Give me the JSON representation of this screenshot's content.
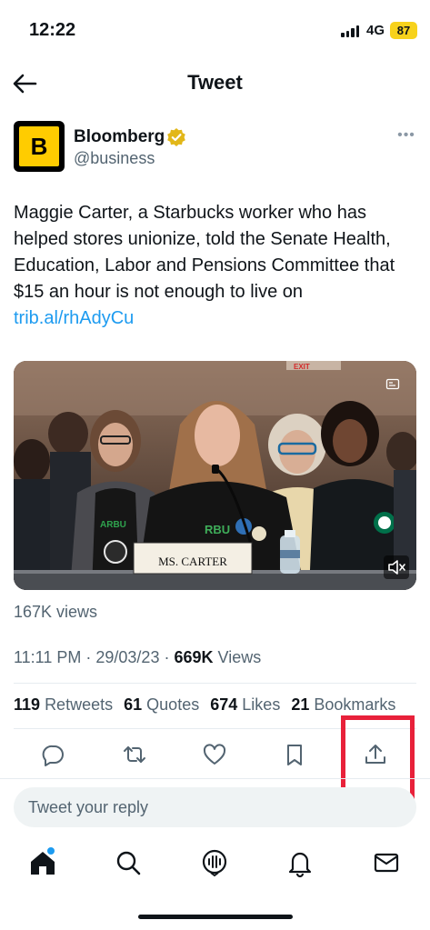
{
  "status_bar": {
    "time": "12:22",
    "network": "4G",
    "battery": "87"
  },
  "header": {
    "title": "Tweet"
  },
  "author": {
    "name": "Bloomberg",
    "handle": "@business",
    "avatar_letter": "B"
  },
  "tweet": {
    "text": "Maggie Carter, a Starbucks worker who has helped stores unionize, told the Senate Health, Education, Labor and Pensions Committee that $15 an hour is not enough to live on ",
    "link": "trib.al/rhAdyCu"
  },
  "media": {
    "nameplate": "MS. CARTER",
    "jersey_text": "RBU",
    "exit_sign": "EXIT"
  },
  "views_label": "167K views",
  "meta": {
    "time": "11:11 PM",
    "date": "29/03/23",
    "views_count": "669K",
    "views_label": "Views"
  },
  "stats": [
    {
      "count": "119",
      "label": "Retweets"
    },
    {
      "count": "61",
      "label": "Quotes"
    },
    {
      "count": "674",
      "label": "Likes"
    },
    {
      "count": "21",
      "label": "Bookmarks"
    }
  ],
  "reply": {
    "placeholder": "Tweet your reply"
  },
  "colors": {
    "accent": "#1d9bf0",
    "highlight": "#e8213a",
    "verified_badge": "#e2b719",
    "battery": "#f7d21c"
  },
  "icons": {
    "actions": [
      "reply-icon",
      "retweet-icon",
      "like-icon",
      "bookmark-icon",
      "share-icon"
    ],
    "tabs": [
      "home-icon",
      "search-icon",
      "spaces-icon",
      "notifications-icon",
      "messages-icon"
    ]
  }
}
